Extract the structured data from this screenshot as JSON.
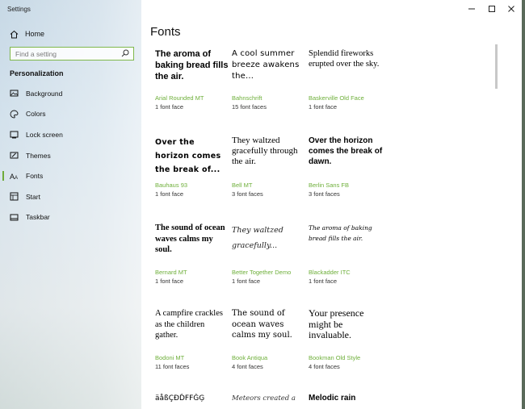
{
  "window": {
    "app_title": "Settings"
  },
  "sidebar": {
    "home_label": "Home",
    "search_placeholder": "Find a setting",
    "section_title": "Personalization",
    "items": [
      {
        "label": "Background",
        "icon": "background-icon"
      },
      {
        "label": "Colors",
        "icon": "colors-icon"
      },
      {
        "label": "Lock screen",
        "icon": "lock-screen-icon"
      },
      {
        "label": "Themes",
        "icon": "themes-icon"
      },
      {
        "label": "Fonts",
        "icon": "fonts-icon",
        "active": true
      },
      {
        "label": "Start",
        "icon": "start-icon"
      },
      {
        "label": "Taskbar",
        "icon": "taskbar-icon"
      }
    ]
  },
  "main": {
    "title": "Fonts",
    "fonts": [
      {
        "preview": "The aroma of baking bread fills the air.",
        "name": "Arial Rounded MT",
        "faces": "1 font face"
      },
      {
        "preview": "A cool summer breeze awakens the...",
        "name": "Bahnschrift",
        "faces": "15 font faces"
      },
      {
        "preview": "Splendid fireworks erupted over the sky.",
        "name": "Baskerville Old Face",
        "faces": "1 font face"
      },
      {
        "preview": "Over the horizon comes the break of...",
        "name": "Bauhaus 93",
        "faces": "1 font face"
      },
      {
        "preview": "They waltzed gracefully through the air.",
        "name": "Bell MT",
        "faces": "3 font faces"
      },
      {
        "preview": "Over the horizon comes the break of dawn.",
        "name": "Berlin Sans FB",
        "faces": "3 font faces"
      },
      {
        "preview": "The sound of ocean waves calms my soul.",
        "name": "Bernard MT",
        "faces": "1 font face"
      },
      {
        "preview": "They waltzed gracefully...",
        "name": "Better Together Demo",
        "faces": "1 font face"
      },
      {
        "preview": "The aroma of baking bread fills the air.",
        "name": "Blackadder ITC",
        "faces": "1 font face"
      },
      {
        "preview": "A campfire crackles as the children gather.",
        "name": "Bodoni MT",
        "faces": "11 font faces"
      },
      {
        "preview": "The sound of ocean waves calms my soul.",
        "name": "Book Antiqua",
        "faces": "4 font faces"
      },
      {
        "preview": "Your presence might be invaluable.",
        "name": "Bookman Old Style",
        "faces": "4 font faces"
      },
      {
        "preview": "äåßÇĐĎFFĞĢ",
        "name": "",
        "faces": ""
      },
      {
        "preview": "Meteors created a",
        "name": "",
        "faces": ""
      },
      {
        "preview": "Melodic rain",
        "name": "",
        "faces": ""
      }
    ]
  },
  "colors": {
    "accent": "#6eaf3a"
  }
}
